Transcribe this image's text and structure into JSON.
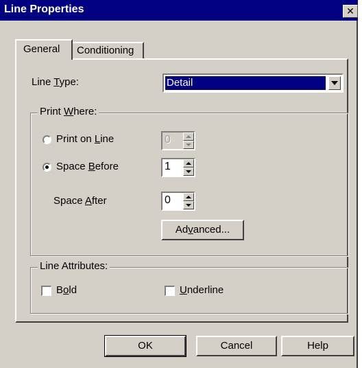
{
  "window": {
    "title": "Line Properties",
    "close_label": "✕"
  },
  "tabs": [
    {
      "label": "General",
      "selected": true
    },
    {
      "label": "Conditioning",
      "selected": false
    }
  ],
  "line_type": {
    "label_pre": "Line ",
    "label_mn": "T",
    "label_post": "ype:",
    "value": "Detail"
  },
  "print_where": {
    "legend_pre": "Print ",
    "legend_mn": "W",
    "legend_post": "here:",
    "print_on_line": {
      "label_pre": "Print on ",
      "label_mn": "L",
      "label_post": "ine",
      "value": "0",
      "checked": false,
      "enabled": false
    },
    "space_before": {
      "label_pre": "Space ",
      "label_mn": "B",
      "label_post": "efore",
      "value": "1",
      "checked": true
    },
    "space_after": {
      "label_pre": "Space ",
      "label_mn": "A",
      "label_post": "fter",
      "value": "0"
    },
    "advanced": {
      "label_pre": "Ad",
      "label_mn": "v",
      "label_post": "anced..."
    }
  },
  "line_attributes": {
    "legend": "Line Attributes:",
    "bold": {
      "label_pre": "B",
      "label_mn": "o",
      "label_post": "ld",
      "checked": false
    },
    "underline": {
      "label_pre": "",
      "label_mn": "U",
      "label_post": "nderline",
      "checked": false
    }
  },
  "buttons": {
    "ok": "OK",
    "cancel": "Cancel",
    "help": "Help"
  },
  "colors": {
    "titlebar": "#000080",
    "face": "#d4d0c8",
    "selection": "#000080"
  }
}
